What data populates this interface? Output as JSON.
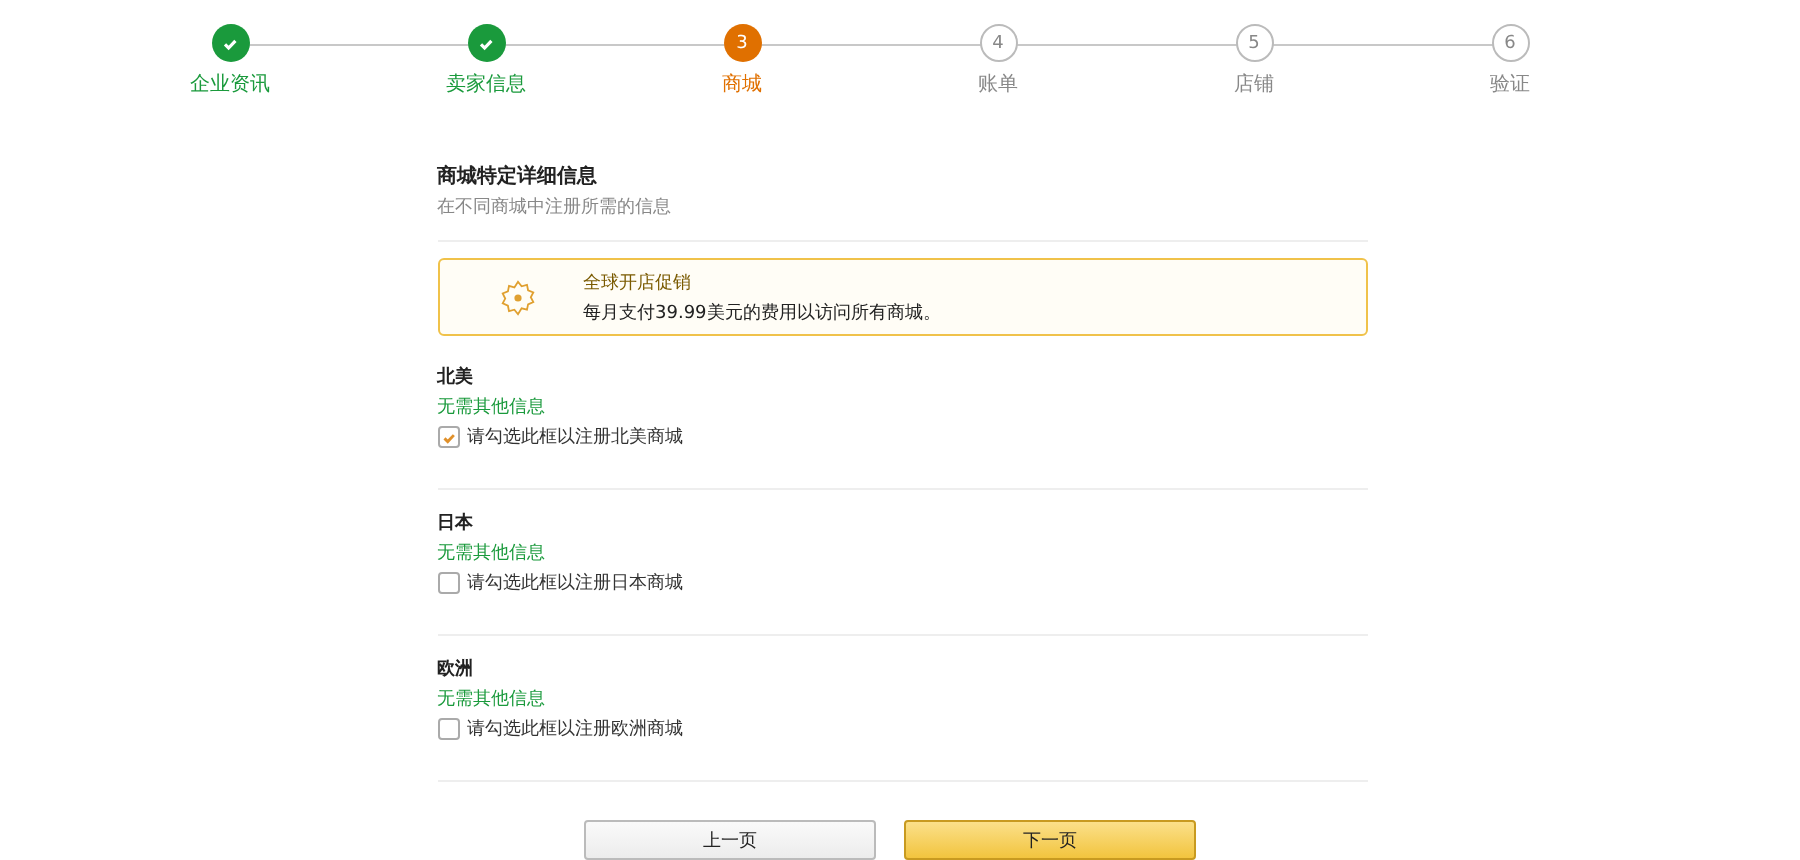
{
  "steps": [
    {
      "label": "企业资讯",
      "completed": true,
      "current": false
    },
    {
      "label": "卖家信息",
      "completed": true,
      "current": false
    },
    {
      "number": "3",
      "label": "商城",
      "completed": false,
      "current": true
    },
    {
      "number": "4",
      "label": "账单",
      "completed": false,
      "current": false
    },
    {
      "number": "5",
      "label": "店铺",
      "completed": false,
      "current": false
    },
    {
      "number": "6",
      "label": "验证",
      "completed": false,
      "current": false
    }
  ],
  "section": {
    "title": "商城特定详细信息",
    "subtitle": "在不同商城中注册所需的信息"
  },
  "promo": {
    "title": "全球开店促销",
    "text": "每月支付39.99美元的费用以访问所有商城。"
  },
  "marketplaces": [
    {
      "name": "北美",
      "note": "无需其他信息",
      "checkbox_label": "请勾选此框以注册北美商城",
      "checked": true
    },
    {
      "name": "日本",
      "note": "无需其他信息",
      "checkbox_label": "请勾选此框以注册日本商城",
      "checked": false
    },
    {
      "name": "欧洲",
      "note": "无需其他信息",
      "checkbox_label": "请勾选此框以注册欧洲商城",
      "checked": false
    }
  ],
  "buttons": {
    "previous": "上一页",
    "next": "下一页"
  }
}
